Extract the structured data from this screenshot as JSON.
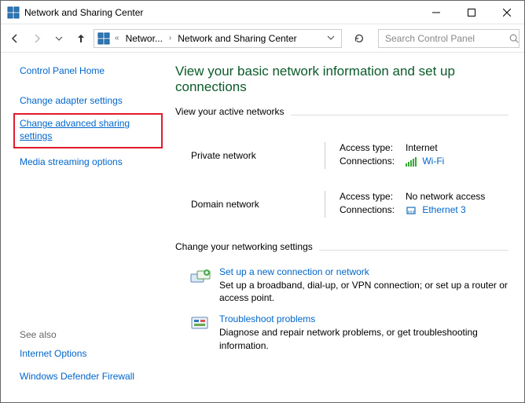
{
  "window": {
    "title": "Network and Sharing Center"
  },
  "breadcrumb": {
    "seg1": "Networ...",
    "seg2": "Network and Sharing Center"
  },
  "search": {
    "placeholder": "Search Control Panel"
  },
  "sidebar": {
    "home": "Control Panel Home",
    "items": [
      "Change adapter settings",
      "Change advanced sharing settings",
      "Media streaming options"
    ],
    "see_also_label": "See also",
    "see_also": [
      "Internet Options",
      "Windows Defender Firewall"
    ]
  },
  "main": {
    "title": "View your basic network information and set up connections",
    "active_networks_label": "View your active networks",
    "networks": [
      {
        "name": "Private network",
        "access_label": "Access type:",
        "access_value": "Internet",
        "conn_label": "Connections:",
        "conn_value": "Wi-Fi",
        "conn_type": "wifi"
      },
      {
        "name": "Domain network",
        "access_label": "Access type:",
        "access_value": "No network access",
        "conn_label": "Connections:",
        "conn_value": "Ethernet 3",
        "conn_type": "ethernet"
      }
    ],
    "change_label": "Change your networking settings",
    "tasks": [
      {
        "title": "Set up a new connection or network",
        "desc": "Set up a broadband, dial-up, or VPN connection; or set up a router or access point."
      },
      {
        "title": "Troubleshoot problems",
        "desc": "Diagnose and repair network problems, or get troubleshooting information."
      }
    ]
  }
}
